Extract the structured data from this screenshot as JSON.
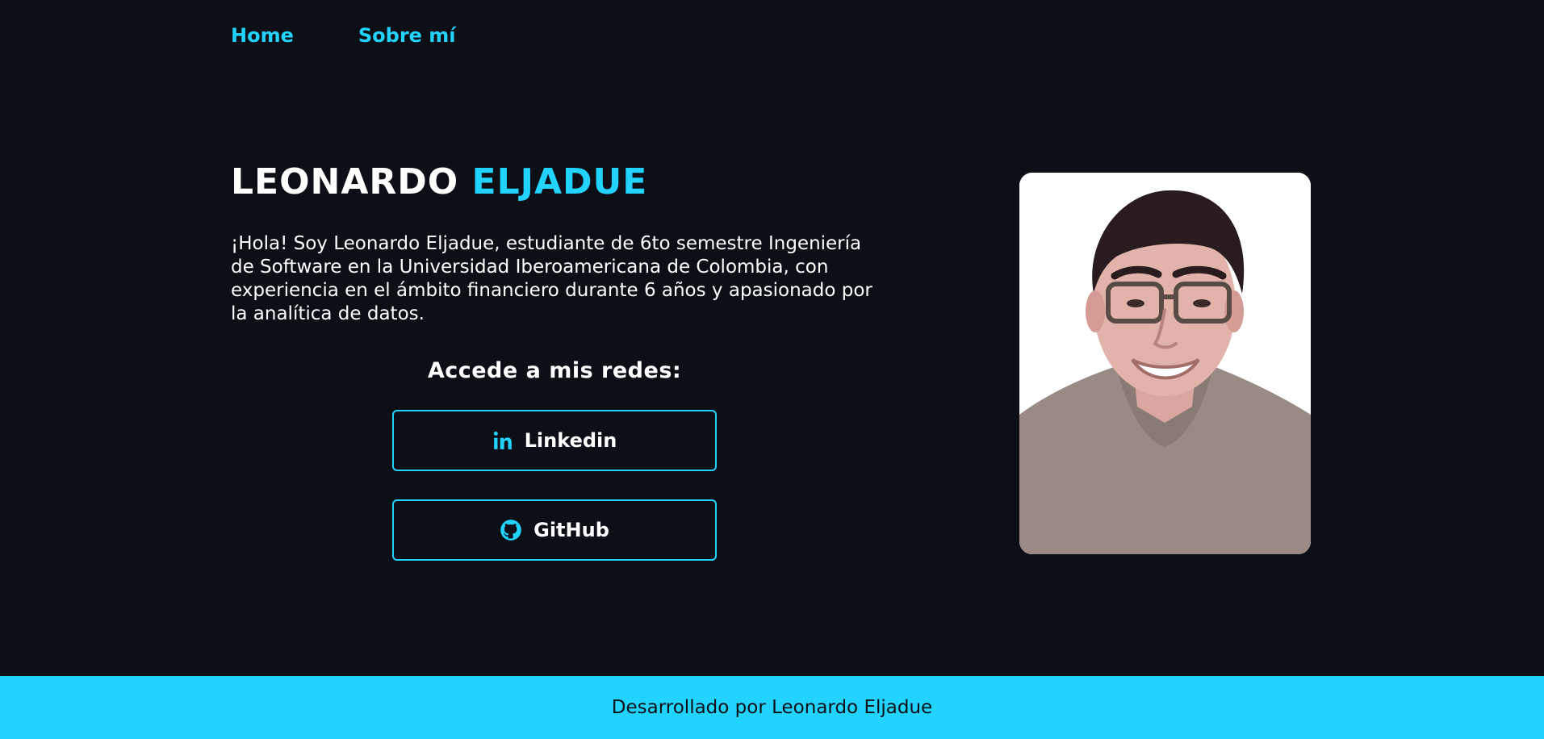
{
  "nav": {
    "items": [
      {
        "label": "Home"
      },
      {
        "label": "Sobre mí"
      }
    ]
  },
  "hero": {
    "name_first": "LEONARDO",
    "name_last": "ELJADUE",
    "intro": "¡Hola! Soy Leonardo Eljadue, estudiante de 6to semestre Ingeniería de Software en la Universidad Iberoamericana de Colombia, con experiencia en el ámbito financiero durante 6 años y apasionado por la analítica de datos.",
    "redes_title": "Accede a mis redes:",
    "linkedin_label": "Linkedin",
    "github_label": "GitHub"
  },
  "footer": {
    "text": "Desarrollado por Leonardo Eljadue"
  },
  "colors": {
    "accent": "#22d3ff",
    "background": "#0c0f16",
    "text": "#ffffff"
  },
  "icons": {
    "linkedin": "linkedin-icon",
    "github": "github-icon"
  }
}
